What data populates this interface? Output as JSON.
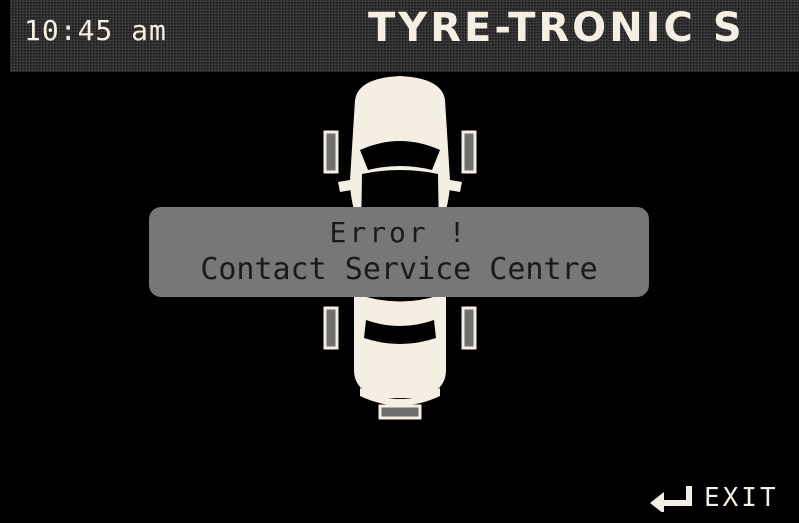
{
  "header": {
    "time": "10:45 am",
    "brand": "TYRE-TRONIC S"
  },
  "vehicle": {
    "icon": "car-top-view-icon",
    "tyres": [
      "front-left",
      "front-right",
      "rear-left",
      "rear-right",
      "spare"
    ]
  },
  "dialog": {
    "title": "Error !",
    "message": "Contact Service Centre"
  },
  "footer": {
    "exit_label": "EXIT",
    "exit_icon": "return-arrow-icon"
  },
  "colors": {
    "background": "#000000",
    "foreground": "#f4efe2",
    "dialog_background": "#777777",
    "dialog_text": "#1a1a1a"
  }
}
